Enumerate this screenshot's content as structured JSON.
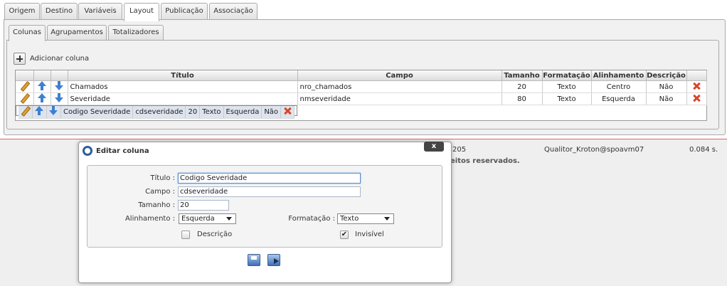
{
  "tabs": [
    "Origem",
    "Destino",
    "Variáveis",
    "Layout",
    "Publicação",
    "Associação"
  ],
  "active_tab": "Layout",
  "subtabs": [
    "Colunas",
    "Agrupamentos",
    "Totalizadores"
  ],
  "active_subtab": "Colunas",
  "add_column_label": "Adicionar coluna",
  "grid": {
    "headers": {
      "titulo": "Título",
      "campo": "Campo",
      "tamanho": "Tamanho",
      "formatacao": "Formatação",
      "alinhamento": "Alinhamento",
      "descricao": "Descrição"
    },
    "rows": [
      {
        "titulo": "Chamados",
        "campo": "nro_chamados",
        "tamanho": "20",
        "formatacao": "Texto",
        "alinhamento": "Centro",
        "descricao": "Não"
      },
      {
        "titulo": "Severidade",
        "campo": "nmseveridade",
        "tamanho": "80",
        "formatacao": "Texto",
        "alinhamento": "Esquerda",
        "descricao": "Não"
      },
      {
        "titulo": "Codigo Severidade",
        "campo": "cdseveridade",
        "tamanho": "20",
        "formatacao": "Texto",
        "alinhamento": "Esquerda",
        "descricao": "Não"
      }
    ]
  },
  "footer": {
    "version_fragment": "205",
    "user": "Qualitor_Kroton@spoavm07",
    "time": "0.084 s.",
    "rights_fragment": "eitos reservados."
  },
  "dialog": {
    "title": "Editar coluna",
    "close_label": "x",
    "titulo_label": "Título :",
    "titulo_value": "Codigo Severidade",
    "campo_label": "Campo :",
    "campo_value": "cdseveridade",
    "tamanho_label": "Tamanho :",
    "tamanho_value": "20",
    "alinhamento_label": "Alinhamento :",
    "alinhamento_value": "Esquerda",
    "formatacao_label": "Formatação :",
    "formatacao_value": "Texto",
    "descricao_label": "Descrição",
    "descricao_checked": false,
    "invisivel_label": "Invisível",
    "invisivel_checked": true
  },
  "colors": {
    "selected_row": "#dde4ee",
    "arrow_blue": "#3f7fcf",
    "delete_red": "#d9442a"
  }
}
